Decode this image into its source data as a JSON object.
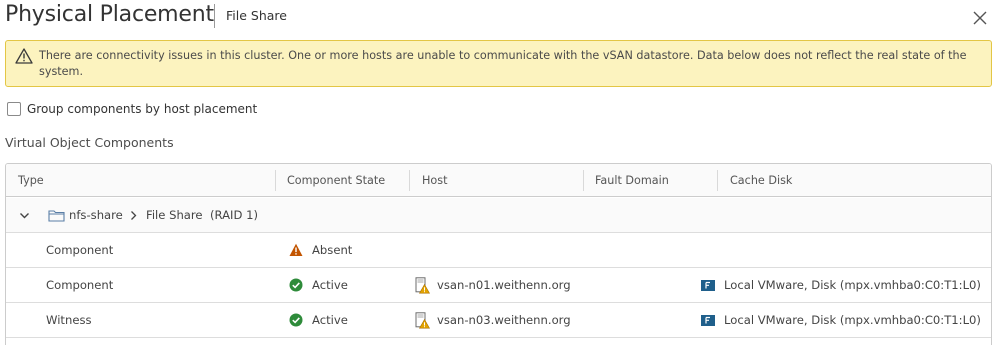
{
  "header": {
    "title": "Physical Placement",
    "subtitle": "File Share"
  },
  "alert": {
    "message": "There are connectivity issues in this cluster. One or more hosts are unable to communicate with the vSAN datastore. Data below does not reflect the real state of the system."
  },
  "options": {
    "group_by_host_label": "Group components by host placement",
    "group_by_host_checked": false
  },
  "section": {
    "title": "Virtual Object Components"
  },
  "table": {
    "columns": [
      "Type",
      "Component State",
      "Host",
      "Fault Domain",
      "Cache Disk"
    ],
    "group": {
      "object_name": "nfs-share",
      "object_type": "File Share",
      "raid": "(RAID 1)"
    },
    "rows": [
      {
        "type": "Component",
        "state": "Absent",
        "state_icon": "warning-icon",
        "host": "",
        "fault_domain": "",
        "cache_disk": ""
      },
      {
        "type": "Component",
        "state": "Active",
        "state_icon": "check-circle-icon",
        "host": "vsan-n01.weithenn.org",
        "fault_domain": "",
        "cache_disk": "Local VMware, Disk (mpx.vmhba0:C0:T1:L0)"
      },
      {
        "type": "Witness",
        "state": "Active",
        "state_icon": "check-circle-icon",
        "host": "vsan-n03.weithenn.org",
        "fault_domain": "",
        "cache_disk": "Local VMware, Disk (mpx.vmhba0:C0:T1:L0)"
      }
    ]
  },
  "colors": {
    "alert_bg": "#fcf3bf",
    "alert_border": "#e3c645",
    "warning": "#c25400",
    "success": "#2e8b3a",
    "folder": "#5a7ea6",
    "disk": "#1f5f8b"
  }
}
